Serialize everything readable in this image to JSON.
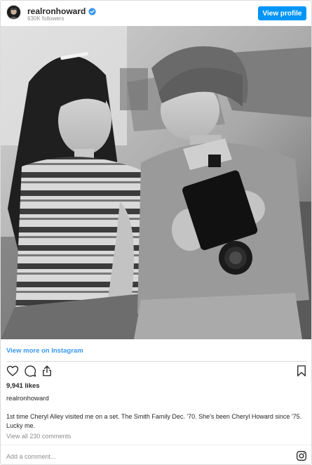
{
  "header": {
    "username": "realronhoward",
    "followers": "630K followers",
    "view_profile_label": "View profile",
    "verified_icon": "verified-badge-icon"
  },
  "post": {
    "view_more_label": "View more on Instagram",
    "likes": "9,941 likes",
    "caption_username": "realronhoward",
    "caption": "1st time Cheryl Alley visited me on a set. The Smith Family Dec. '70. She's been Cheryl Howard since '75. Lucky me.",
    "view_comments": "View all 230 comments",
    "comment_placeholder": "Add a comment...",
    "icons": [
      "heart-icon",
      "comment-icon",
      "share-icon",
      "bookmark-icon",
      "instagram-logo-icon"
    ]
  },
  "colors": {
    "primary_button": "#0095f6",
    "link_blue": "#3897f0",
    "muted_text": "#8e8e8e"
  }
}
